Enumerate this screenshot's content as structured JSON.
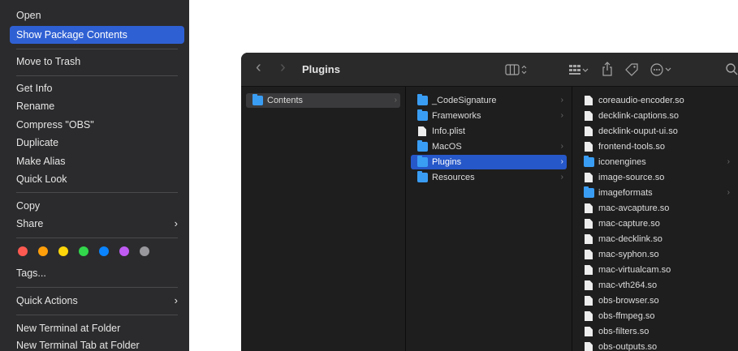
{
  "context_menu": {
    "open": "Open",
    "show_package_contents": "Show Package Contents",
    "move_to_trash": "Move to Trash",
    "get_info": "Get Info",
    "rename": "Rename",
    "compress": "Compress \"OBS\"",
    "duplicate": "Duplicate",
    "make_alias": "Make Alias",
    "quick_look": "Quick Look",
    "copy": "Copy",
    "share": "Share",
    "tags_label": "Tags...",
    "quick_actions": "Quick Actions",
    "new_terminal": "New Terminal at Folder",
    "new_terminal_tab": "New Terminal Tab at Folder",
    "submenu_arrow": "›",
    "tag_colors": [
      {
        "name": "red",
        "color": "#ff5a52"
      },
      {
        "name": "orange",
        "color": "#ff9f0a"
      },
      {
        "name": "yellow",
        "color": "#ffd60a"
      },
      {
        "name": "green",
        "color": "#32d74b"
      },
      {
        "name": "blue",
        "color": "#0a84ff"
      },
      {
        "name": "purple",
        "color": "#bf5af2"
      },
      {
        "name": "gray",
        "color": "#98989d"
      }
    ]
  },
  "finder": {
    "title": "Plugins",
    "back_glyph": "‹",
    "forward_glyph": "›",
    "column1": [
      {
        "label": "Contents",
        "type": "folder",
        "state": "selected-dim"
      }
    ],
    "column2": [
      {
        "label": "_CodeSignature",
        "type": "folder"
      },
      {
        "label": "Frameworks",
        "type": "folder"
      },
      {
        "label": "Info.plist",
        "type": "file"
      },
      {
        "label": "MacOS",
        "type": "folder"
      },
      {
        "label": "Plugins",
        "type": "folder",
        "state": "selected"
      },
      {
        "label": "Resources",
        "type": "folder"
      }
    ],
    "column3": [
      {
        "label": "coreaudio-encoder.so",
        "type": "file"
      },
      {
        "label": "decklink-captions.so",
        "type": "file"
      },
      {
        "label": "decklink-ouput-ui.so",
        "type": "file"
      },
      {
        "label": "frontend-tools.so",
        "type": "file"
      },
      {
        "label": "iconengines",
        "type": "folder"
      },
      {
        "label": "image-source.so",
        "type": "file"
      },
      {
        "label": "imageformats",
        "type": "folder"
      },
      {
        "label": "mac-avcapture.so",
        "type": "file"
      },
      {
        "label": "mac-capture.so",
        "type": "file"
      },
      {
        "label": "mac-decklink.so",
        "type": "file"
      },
      {
        "label": "mac-syphon.so",
        "type": "file"
      },
      {
        "label": "mac-virtualcam.so",
        "type": "file"
      },
      {
        "label": "mac-vth264.so",
        "type": "file"
      },
      {
        "label": "obs-browser.so",
        "type": "file"
      },
      {
        "label": "obs-ffmpeg.so",
        "type": "file"
      },
      {
        "label": "obs-filters.so",
        "type": "file"
      },
      {
        "label": "obs-outputs.so",
        "type": "file"
      }
    ],
    "chevron": "›",
    "toolbar_icons": [
      "back-icon",
      "forward-icon",
      "column-view-icon",
      "group-icon",
      "share-icon",
      "tag-icon",
      "more-icon",
      "search-icon"
    ]
  }
}
